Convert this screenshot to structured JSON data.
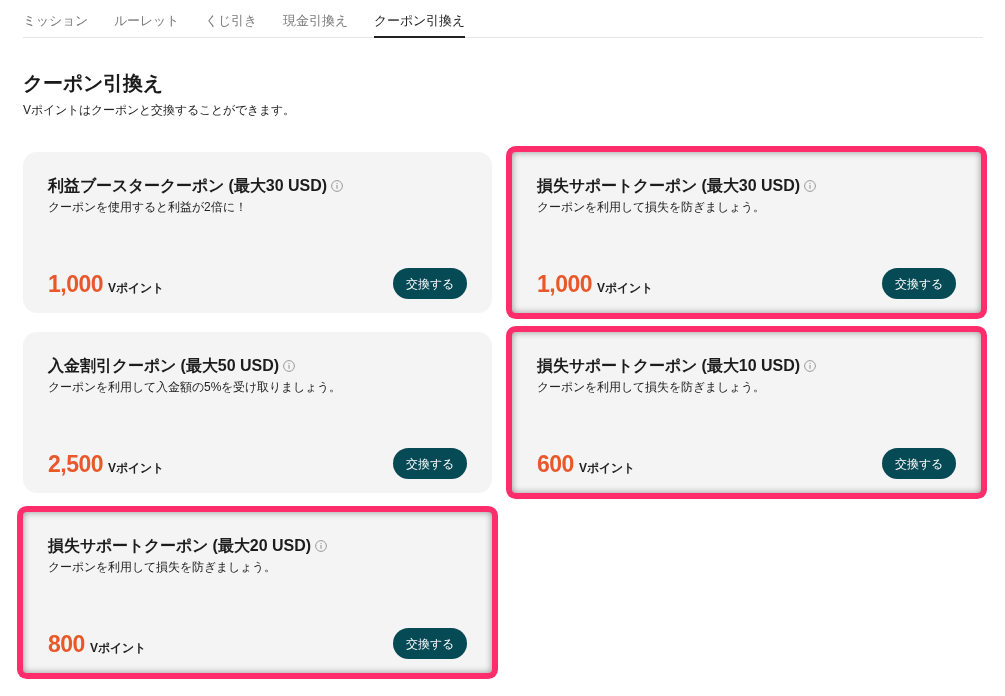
{
  "tabs": [
    {
      "label": "ミッション",
      "selected": false
    },
    {
      "label": "ルーレット",
      "selected": false
    },
    {
      "label": "くじ引き",
      "selected": false
    },
    {
      "label": "現金引換え",
      "selected": false
    },
    {
      "label": "クーポン引換え",
      "selected": true
    }
  ],
  "page": {
    "title": "クーポン引換え",
    "subtitle": "Vポイントはクーポンと交換することができます。"
  },
  "coupons": [
    {
      "title": "利益ブースタークーポン (最大30 USD)",
      "description": "クーポンを使用すると利益が2倍に！",
      "points": "1,000",
      "unit": "Vポイント",
      "button": "交換する",
      "highlighted": false
    },
    {
      "title": "損失サポートクーポン (最大30 USD)",
      "description": "クーポンを利用して損失を防ぎましょう。",
      "points": "1,000",
      "unit": "Vポイント",
      "button": "交換する",
      "highlighted": true
    },
    {
      "title": "入金割引クーポン (最大50 USD)",
      "description": "クーポンを利用して入金額の5%を受け取りましょう。",
      "points": "2,500",
      "unit": "Vポイント",
      "button": "交換する",
      "highlighted": false
    },
    {
      "title": "損失サポートクーポン (最大10 USD)",
      "description": "クーポンを利用して損失を防ぎましょう。",
      "points": "600",
      "unit": "Vポイント",
      "button": "交換する",
      "highlighted": true
    },
    {
      "title": "損失サポートクーポン (最大20 USD)",
      "description": "クーポンを利用して損失を防ぎましょう。",
      "points": "800",
      "unit": "Vポイント",
      "button": "交換する",
      "highlighted": true
    }
  ]
}
